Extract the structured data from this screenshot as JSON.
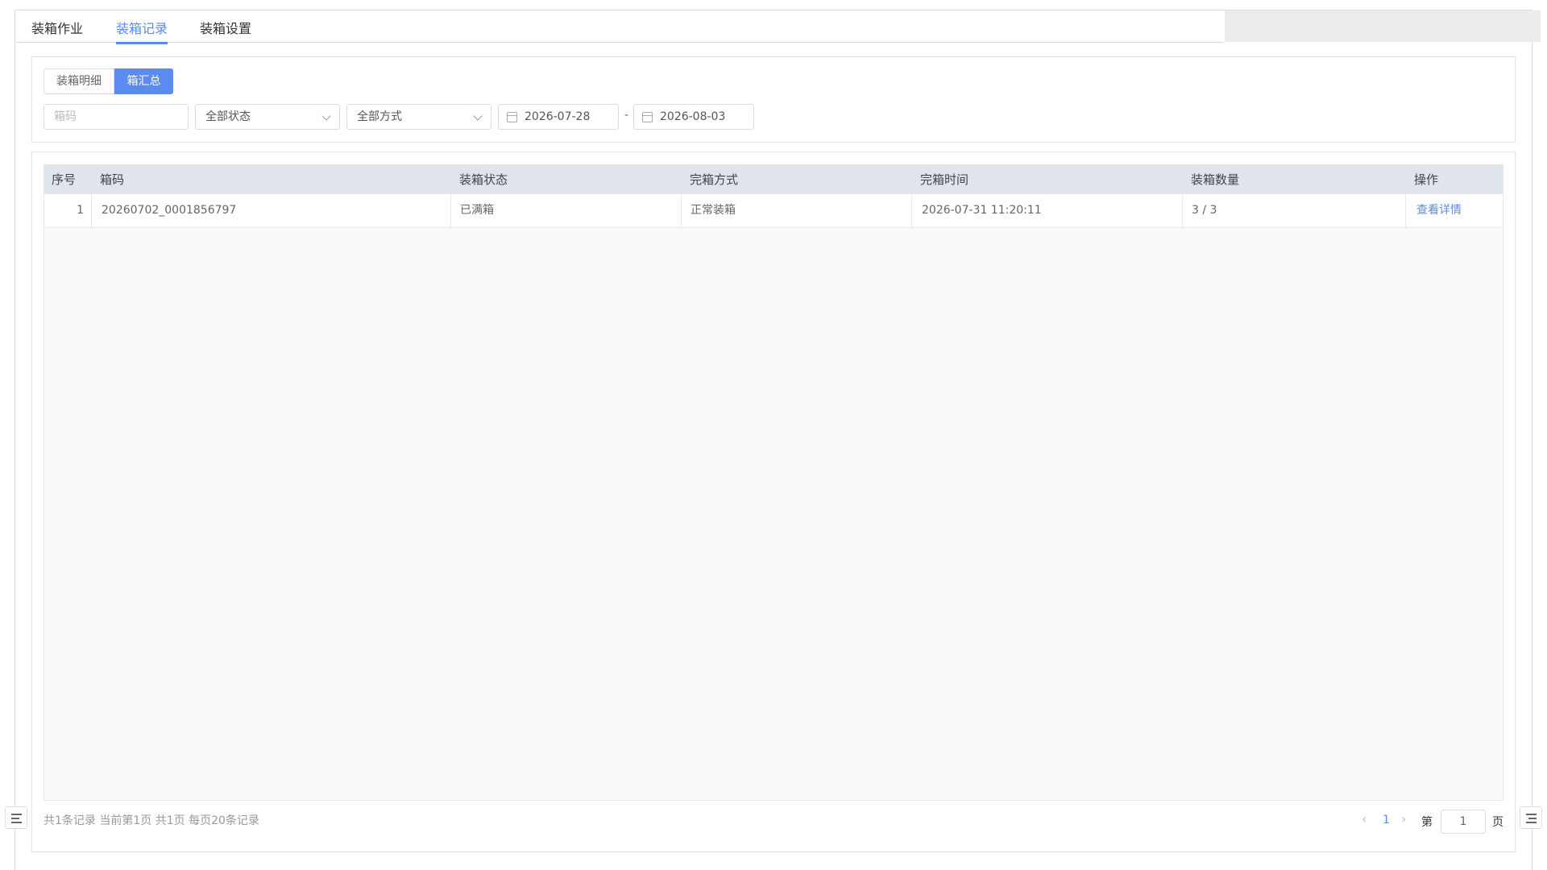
{
  "tabs": [
    {
      "label": "装箱作业",
      "active": false
    },
    {
      "label": "装箱记录",
      "active": true
    },
    {
      "label": "装箱设置",
      "active": false
    }
  ],
  "view_toggle": {
    "detail_label": "装箱明细",
    "summary_label": "箱汇总",
    "selected": "箱汇总"
  },
  "filters": {
    "box_code_placeholder": "箱码",
    "status_value": "全部状态",
    "method_value": "全部方式",
    "date_start": "2026-07-28",
    "date_separator": "-",
    "date_end": "2026-08-03"
  },
  "table": {
    "columns": [
      "序号",
      "箱码",
      "装箱状态",
      "完箱方式",
      "完箱时间",
      "装箱数量",
      "操作"
    ],
    "rows": [
      {
        "index": "1",
        "box_code": "20260702_0001856797",
        "status": "已满箱",
        "method": "正常装箱",
        "finish_time": "2026-07-31 11:20:11",
        "quantity": "3 / 3",
        "action": "查看详情"
      }
    ]
  },
  "footer": {
    "summary": "共1条记录 当前第1页 共1页 每页20条记录"
  },
  "pagination": {
    "prev": "‹",
    "current_page": "1",
    "next": "›",
    "goto_prefix": "第",
    "goto_value": "1",
    "goto_suffix": "页"
  },
  "icons": [
    "calendar-icon",
    "chevron-down-icon",
    "menu-collapse-icon",
    "menu-expand-icon"
  ],
  "colors": {
    "accent": "#5b8af0",
    "header_bg": "#e0e4ec"
  }
}
